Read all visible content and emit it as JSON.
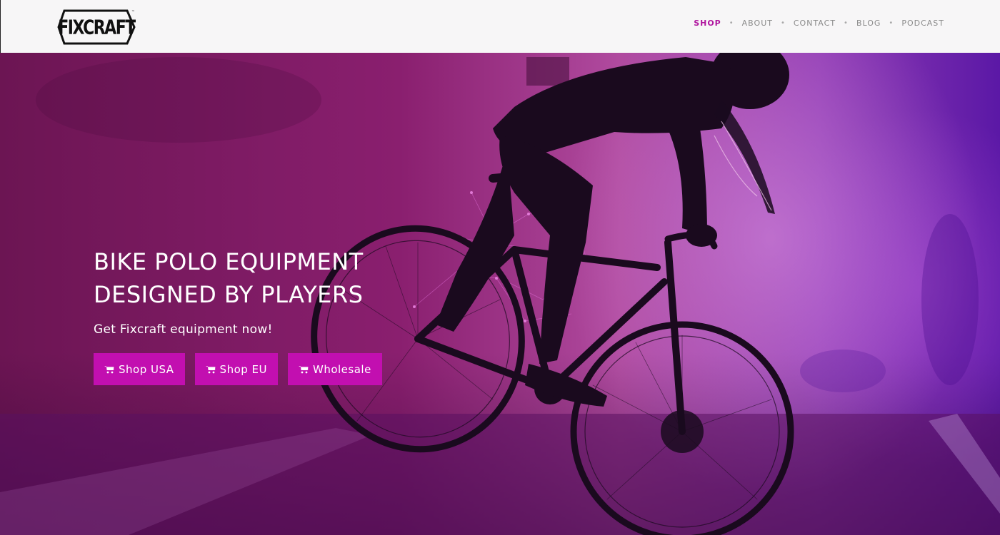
{
  "brand": {
    "logo_text": "FIXCRAFT",
    "logo_icon": "fixcraft-logo"
  },
  "nav": {
    "items": [
      {
        "label": "SHOP",
        "active": true
      },
      {
        "label": "ABOUT",
        "active": false
      },
      {
        "label": "CONTACT",
        "active": false
      },
      {
        "label": "BLOG",
        "active": false
      },
      {
        "label": "PODCAST",
        "active": false
      }
    ],
    "separator": "•"
  },
  "hero": {
    "title_line1": "BIKE POLO EQUIPMENT",
    "title_line2": "DESIGNED BY PLAYERS",
    "subtitle": "Get Fixcraft equipment now!",
    "buttons": [
      {
        "label": "Shop USA",
        "icon": "cart-icon"
      },
      {
        "label": "Shop EU",
        "icon": "cart-icon"
      },
      {
        "label": "Wholesale",
        "icon": "cart-icon"
      }
    ]
  },
  "colors": {
    "accent": "#c20fb0",
    "nav_active": "#b0169f",
    "nav_text": "#8a8a8a",
    "navbar_bg": "#f7f6f7",
    "hero_overlay": "#8a1f6f"
  }
}
